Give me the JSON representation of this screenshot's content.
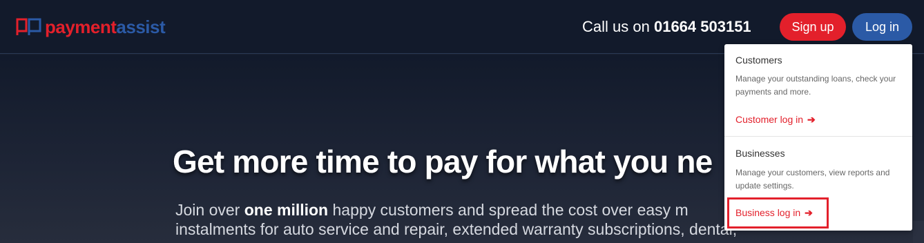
{
  "brand": {
    "logo_text_red": "payment",
    "logo_text_blue": "assist",
    "colors": {
      "red": "#e3202b",
      "blue": "#2b5aa6",
      "navy": "#121a2b"
    }
  },
  "header": {
    "call_prefix": "Call us on",
    "phone": "01664 503151",
    "signup_label": "Sign up",
    "login_label": "Log in"
  },
  "hero": {
    "headline": "Get more time to pay for what you ne",
    "sub_line1_pre": "Join over",
    "sub_line1_bold": "one million",
    "sub_line1_post": "happy customers and spread the cost over easy m",
    "sub_line2": "instalments for auto service and repair, extended warranty subscriptions, dental,"
  },
  "login_dropdown": {
    "customers": {
      "title": "Customers",
      "description": "Manage your outstanding loans, check your payments and more.",
      "link": "Customer log in"
    },
    "businesses": {
      "title": "Businesses",
      "description": "Manage your customers, view reports and update settings.",
      "link": "Business log in"
    }
  },
  "icons": {
    "link_arrow": "arrow-right-icon"
  }
}
